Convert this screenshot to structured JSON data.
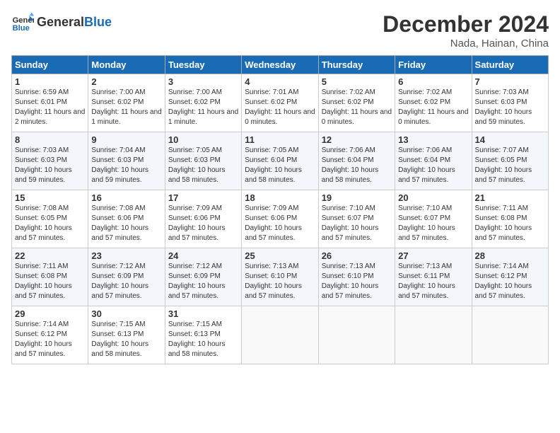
{
  "header": {
    "logo_line1": "General",
    "logo_line2": "Blue",
    "month": "December 2024",
    "location": "Nada, Hainan, China"
  },
  "weekdays": [
    "Sunday",
    "Monday",
    "Tuesday",
    "Wednesday",
    "Thursday",
    "Friday",
    "Saturday"
  ],
  "weeks": [
    [
      {
        "day": "1",
        "sunrise": "6:59 AM",
        "sunset": "6:01 PM",
        "daylight": "11 hours and 2 minutes."
      },
      {
        "day": "2",
        "sunrise": "7:00 AM",
        "sunset": "6:02 PM",
        "daylight": "11 hours and 1 minute."
      },
      {
        "day": "3",
        "sunrise": "7:00 AM",
        "sunset": "6:02 PM",
        "daylight": "11 hours and 1 minute."
      },
      {
        "day": "4",
        "sunrise": "7:01 AM",
        "sunset": "6:02 PM",
        "daylight": "11 hours and 0 minutes."
      },
      {
        "day": "5",
        "sunrise": "7:02 AM",
        "sunset": "6:02 PM",
        "daylight": "11 hours and 0 minutes."
      },
      {
        "day": "6",
        "sunrise": "7:02 AM",
        "sunset": "6:02 PM",
        "daylight": "11 hours and 0 minutes."
      },
      {
        "day": "7",
        "sunrise": "7:03 AM",
        "sunset": "6:03 PM",
        "daylight": "10 hours and 59 minutes."
      }
    ],
    [
      {
        "day": "8",
        "sunrise": "7:03 AM",
        "sunset": "6:03 PM",
        "daylight": "10 hours and 59 minutes."
      },
      {
        "day": "9",
        "sunrise": "7:04 AM",
        "sunset": "6:03 PM",
        "daylight": "10 hours and 59 minutes."
      },
      {
        "day": "10",
        "sunrise": "7:05 AM",
        "sunset": "6:03 PM",
        "daylight": "10 hours and 58 minutes."
      },
      {
        "day": "11",
        "sunrise": "7:05 AM",
        "sunset": "6:04 PM",
        "daylight": "10 hours and 58 minutes."
      },
      {
        "day": "12",
        "sunrise": "7:06 AM",
        "sunset": "6:04 PM",
        "daylight": "10 hours and 58 minutes."
      },
      {
        "day": "13",
        "sunrise": "7:06 AM",
        "sunset": "6:04 PM",
        "daylight": "10 hours and 57 minutes."
      },
      {
        "day": "14",
        "sunrise": "7:07 AM",
        "sunset": "6:05 PM",
        "daylight": "10 hours and 57 minutes."
      }
    ],
    [
      {
        "day": "15",
        "sunrise": "7:08 AM",
        "sunset": "6:05 PM",
        "daylight": "10 hours and 57 minutes."
      },
      {
        "day": "16",
        "sunrise": "7:08 AM",
        "sunset": "6:06 PM",
        "daylight": "10 hours and 57 minutes."
      },
      {
        "day": "17",
        "sunrise": "7:09 AM",
        "sunset": "6:06 PM",
        "daylight": "10 hours and 57 minutes."
      },
      {
        "day": "18",
        "sunrise": "7:09 AM",
        "sunset": "6:06 PM",
        "daylight": "10 hours and 57 minutes."
      },
      {
        "day": "19",
        "sunrise": "7:10 AM",
        "sunset": "6:07 PM",
        "daylight": "10 hours and 57 minutes."
      },
      {
        "day": "20",
        "sunrise": "7:10 AM",
        "sunset": "6:07 PM",
        "daylight": "10 hours and 57 minutes."
      },
      {
        "day": "21",
        "sunrise": "7:11 AM",
        "sunset": "6:08 PM",
        "daylight": "10 hours and 57 minutes."
      }
    ],
    [
      {
        "day": "22",
        "sunrise": "7:11 AM",
        "sunset": "6:08 PM",
        "daylight": "10 hours and 57 minutes."
      },
      {
        "day": "23",
        "sunrise": "7:12 AM",
        "sunset": "6:09 PM",
        "daylight": "10 hours and 57 minutes."
      },
      {
        "day": "24",
        "sunrise": "7:12 AM",
        "sunset": "6:09 PM",
        "daylight": "10 hours and 57 minutes."
      },
      {
        "day": "25",
        "sunrise": "7:13 AM",
        "sunset": "6:10 PM",
        "daylight": "10 hours and 57 minutes."
      },
      {
        "day": "26",
        "sunrise": "7:13 AM",
        "sunset": "6:10 PM",
        "daylight": "10 hours and 57 minutes."
      },
      {
        "day": "27",
        "sunrise": "7:13 AM",
        "sunset": "6:11 PM",
        "daylight": "10 hours and 57 minutes."
      },
      {
        "day": "28",
        "sunrise": "7:14 AM",
        "sunset": "6:12 PM",
        "daylight": "10 hours and 57 minutes."
      }
    ],
    [
      {
        "day": "29",
        "sunrise": "7:14 AM",
        "sunset": "6:12 PM",
        "daylight": "10 hours and 57 minutes."
      },
      {
        "day": "30",
        "sunrise": "7:15 AM",
        "sunset": "6:13 PM",
        "daylight": "10 hours and 58 minutes."
      },
      {
        "day": "31",
        "sunrise": "7:15 AM",
        "sunset": "6:13 PM",
        "daylight": "10 hours and 58 minutes."
      },
      null,
      null,
      null,
      null
    ]
  ]
}
